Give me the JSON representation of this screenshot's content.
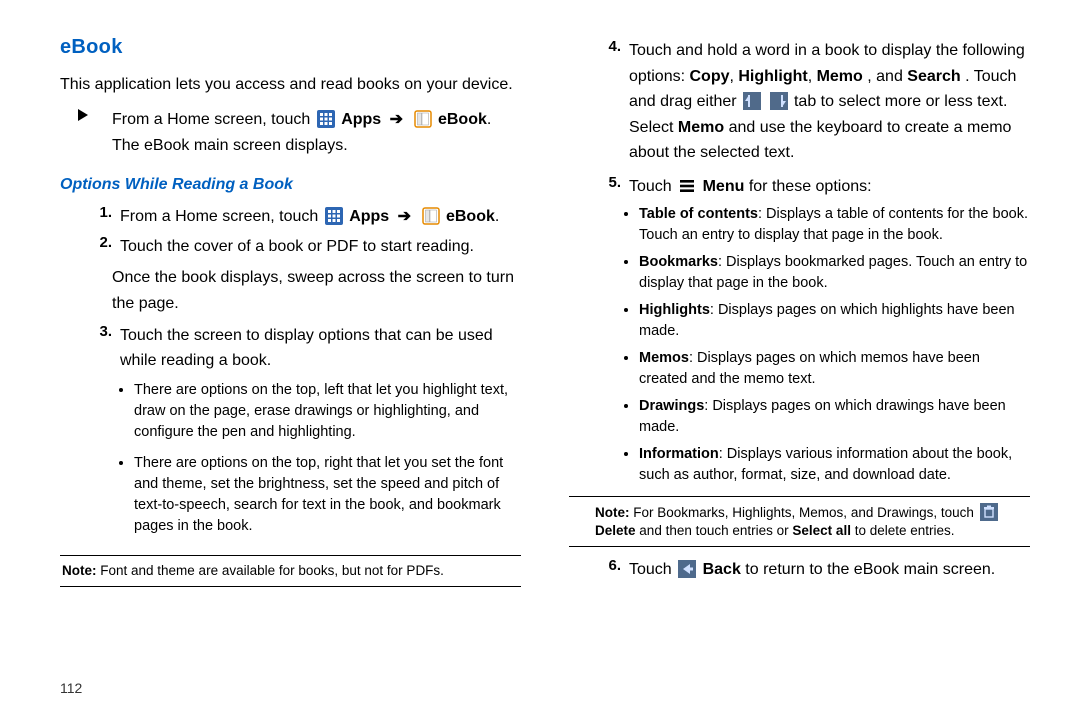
{
  "page_number": "112",
  "title": "eBook",
  "intro": "This application lets you access and read books on your device.",
  "labels": {
    "apps": "Apps",
    "ebook": "eBook",
    "arrow": "➔",
    "menu": "Menu",
    "back": "Back",
    "delete": "Delete",
    "copy": "Copy",
    "highlight": "Highlight",
    "memo_word": "Memo",
    "search": "Search",
    "memo_sentence": "Memo",
    "select_all": "Select all"
  },
  "open_step": {
    "line1a": "From a Home screen, touch",
    "line2": "The eBook main screen displays."
  },
  "subsection": "Options While Reading a Book",
  "steps": {
    "s1": "From a Home screen, touch",
    "s2": "Touch the cover of a book or PDF to start reading.",
    "s2b": "Once the book displays, sweep across the screen to turn the page.",
    "s3": "Touch the screen to display options that can be used while reading a book.",
    "s3_b1": "There are options on the top, left that let you highlight text, draw on the page, erase drawings or highlighting, and configure the pen and highlighting.",
    "s3_b2": "There are options on the top, right that let you set the font and theme, set the brightness, set the speed and pitch of text-to-speech, search for text in the book, and bookmark pages in the book.",
    "s4_a": "Touch and hold a word in a book to display the following options: ",
    "s4_b": ", and ",
    "s4_c": ". Touch and drag either ",
    "s4_d": " tab to select more or less text. Select ",
    "s4_e": " and use the keyboard to create a memo about the selected text.",
    "s5": "Touch ",
    "s5b": " for these options:",
    "s6a": "Touch ",
    "s6b": " to return to the eBook main screen."
  },
  "menu_items": [
    {
      "lead": "Table of contents",
      "rest": ": Displays a table of contents for the book. Touch an entry to display that page in the book."
    },
    {
      "lead": "Bookmarks",
      "rest": ": Displays bookmarked pages. Touch an entry to display that page in the book."
    },
    {
      "lead": "Highlights",
      "rest": ": Displays pages on which highlights have been made."
    },
    {
      "lead": "Memos",
      "rest": ": Displays pages on which memos have been created and the memo text."
    },
    {
      "lead": "Drawings",
      "rest": ": Displays pages on which drawings have been made."
    },
    {
      "lead": "Information",
      "rest": ": Displays various information about the book, such as author, format, size, and download date."
    }
  ],
  "note_left_lead": "Note:",
  "note_left": " Font and theme are available for books, but not for PDFs.",
  "note_right_lead": "Note:",
  "note_right_a": " For Bookmarks, Highlights, Memos, and Drawings, touch ",
  "note_right_b": " and then touch entries or ",
  "note_right_c": " to delete entries."
}
